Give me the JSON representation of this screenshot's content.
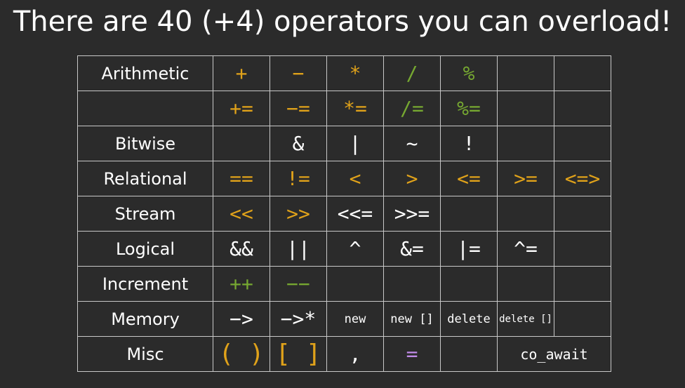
{
  "title": "There are 40 (+4) operators you can overload!",
  "colors": {
    "background": "#2b2b2b",
    "orange": "#e0a21a",
    "green": "#76a831",
    "white": "#ffffff",
    "purple": "#c08be8",
    "grid": "#c8c8c8"
  },
  "rows": [
    {
      "category": "Arithmetic",
      "cells": [
        "+",
        "−",
        "*",
        "/",
        "%",
        "",
        ""
      ]
    },
    {
      "category": "",
      "cells": [
        "+=",
        "−=",
        "*=",
        "/=",
        "%=",
        "",
        ""
      ]
    },
    {
      "category": "Bitwise",
      "cells": [
        "",
        "&",
        "|",
        "~",
        "!",
        "",
        ""
      ]
    },
    {
      "category": "Relational",
      "cells": [
        "==",
        "!=",
        "<",
        ">",
        "<=",
        ">=",
        "<=>"
      ]
    },
    {
      "category": "Stream",
      "cells": [
        "<<",
        ">>",
        "<<=",
        ">>=",
        "",
        "",
        ""
      ]
    },
    {
      "category": "Logical",
      "cells": [
        "&&",
        "||",
        "^",
        "&=",
        "|=",
        "^=",
        ""
      ]
    },
    {
      "category": "Increment",
      "cells": [
        "++",
        "−−",
        "",
        "",
        "",
        "",
        ""
      ]
    },
    {
      "category": "Memory",
      "cells": [
        "−>",
        "−>*",
        "new",
        "new []",
        "delete",
        "delete []",
        ""
      ]
    },
    {
      "category": "Misc",
      "cells": [
        "( )",
        "[ ]",
        ",",
        "=",
        "",
        "co_await"
      ]
    }
  ]
}
